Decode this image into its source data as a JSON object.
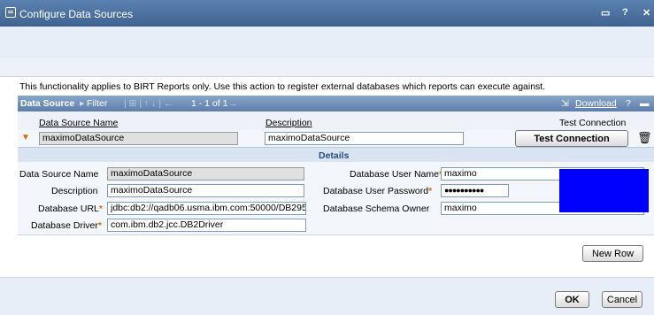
{
  "window": {
    "title": "Configure Data Sources",
    "controls": [
      "▭",
      "?",
      "✕"
    ]
  },
  "intro_text": "This functionality applies to BIRT Reports only. Use this action to register external databases which reports can execute against.",
  "table": {
    "name": "Data Source",
    "filter_label": "Filter",
    "paging": "1 - 1 of 1",
    "download_label": "Download",
    "help_label": "?",
    "columns": {
      "name": "Data Source Name",
      "description": "Description",
      "test": "Test Connection"
    },
    "row": {
      "name": "maximoDataSource",
      "description": "maximoDataSource",
      "test_button": "Test Connection"
    }
  },
  "details": {
    "header": "Details",
    "labels": {
      "ds_name": "Data Source Name",
      "description": "Description",
      "url": "Database URL",
      "driver": "Database Driver",
      "user": "Database User Name",
      "password": "Database User Password",
      "schema": "Database Schema Owner"
    },
    "values": {
      "ds_name": "maximoDataSource",
      "description": "maximoDataSource",
      "url": "jdbc:db2://qadb06.usma.ibm.com:50000/DB295",
      "driver": "com.ibm.db2.jcc.DB2Driver",
      "user": "maximo",
      "password": "●●●●●●●●●●",
      "schema": "maximo"
    }
  },
  "buttons": {
    "new_row": "New Row",
    "ok": "OK",
    "cancel": "Cancel"
  },
  "colors": {
    "title_bar": "#4a6f9c",
    "required": "#e06a00",
    "redaction": "#0000ff"
  }
}
